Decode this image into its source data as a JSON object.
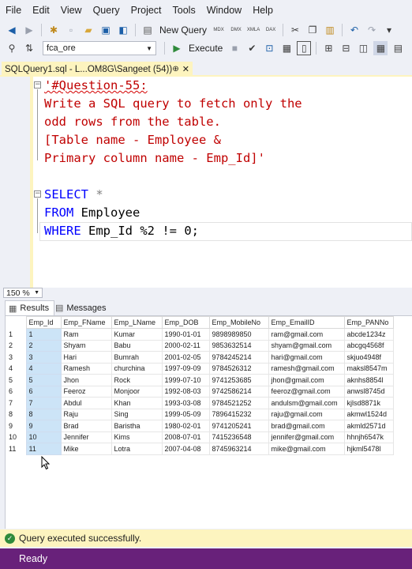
{
  "menu": [
    "File",
    "Edit",
    "View",
    "Query",
    "Project",
    "Tools",
    "Window",
    "Help"
  ],
  "toolbar": {
    "new_query_label": "New Query",
    "execute_label": "Execute",
    "database_value": "fca_ore",
    "mini_icons": [
      "MDX",
      "DMX",
      "XMLA",
      "DAX"
    ]
  },
  "tab": {
    "title": "SQLQuery1.sql - L...OM8G\\Sangeet (54))*",
    "pin": "⊕",
    "close": "✕"
  },
  "editor": {
    "lines": [
      "'#Question-55:",
      "Write a SQL query to fetch only the",
      "odd rows from the table.",
      "[Table name - Employee &",
      "Primary column name - Emp_Id]'",
      "",
      "SELECT *",
      "FROM Employee",
      "WHERE Emp_Id %2 != 0;"
    ],
    "kw_select": "SELECT",
    "star": " *",
    "kw_from": "FROM",
    "from_rest": " Employee",
    "kw_where": "WHERE",
    "where_rest": " Emp_Id %2 != 0;"
  },
  "zoom": "150 %",
  "results_tabs": [
    "Results",
    "Messages"
  ],
  "columns": [
    "Emp_Id",
    "Emp_FName",
    "Emp_LName",
    "Emp_DOB",
    "Emp_MobileNo",
    "Emp_EmailID",
    "Emp_PANNo"
  ],
  "rows": [
    [
      "1",
      "1",
      "Ram",
      "Kumar",
      "1990-01-01",
      "9898989850",
      "ram@gmail.com",
      "abcde1234z"
    ],
    [
      "2",
      "2",
      "Shyam",
      "Babu",
      "2000-02-11",
      "9853632514",
      "shyam@gmail.com",
      "abcgq4568f"
    ],
    [
      "3",
      "3",
      "Hari",
      "Bumrah",
      "2001-02-05",
      "9784245214",
      "hari@gmail.com",
      "skjuo4948f"
    ],
    [
      "4",
      "4",
      "Ramesh",
      "churchina",
      "1997-09-09",
      "9784526312",
      "ramesh@gmail.com",
      "maksl8547m"
    ],
    [
      "5",
      "5",
      "Jhon",
      "Rock",
      "1999-07-10",
      "9741253685",
      "jhon@gmail.com",
      "aknhs8854l"
    ],
    [
      "6",
      "6",
      "Feeroz",
      "Monjoor",
      "1992-08-03",
      "9742586214",
      "feeroz@gmail.com",
      "anwsl8745d"
    ],
    [
      "7",
      "7",
      "Abdul",
      "Khan",
      "1993-03-08",
      "9784521252",
      "andulsm@gmail.com",
      "kjlsd8871k"
    ],
    [
      "8",
      "8",
      "Raju",
      "Sing",
      "1999-05-09",
      "7896415232",
      "raju@gmail.com",
      "akmwl1524d"
    ],
    [
      "9",
      "9",
      "Brad",
      "Baristha",
      "1980-02-01",
      "9741205241",
      "brad@gmail.com",
      "akmld2571d"
    ],
    [
      "10",
      "10",
      "Jennifer",
      "Kims",
      "2008-07-01",
      "7415236548",
      "jennifer@gmail.com",
      "hhnjh6547k"
    ],
    [
      "11",
      "11",
      "Mike",
      "Lotra",
      "2007-04-08",
      "8745963214",
      "mike@gmail.com",
      "hjkml5478l"
    ]
  ],
  "status_message": "Query executed successfully.",
  "status_bar": "Ready",
  "colors": {
    "status_bar": "#68217a",
    "tab_active": "#fdf4bf",
    "keyword": "#0000ff",
    "string": "#c00000"
  }
}
